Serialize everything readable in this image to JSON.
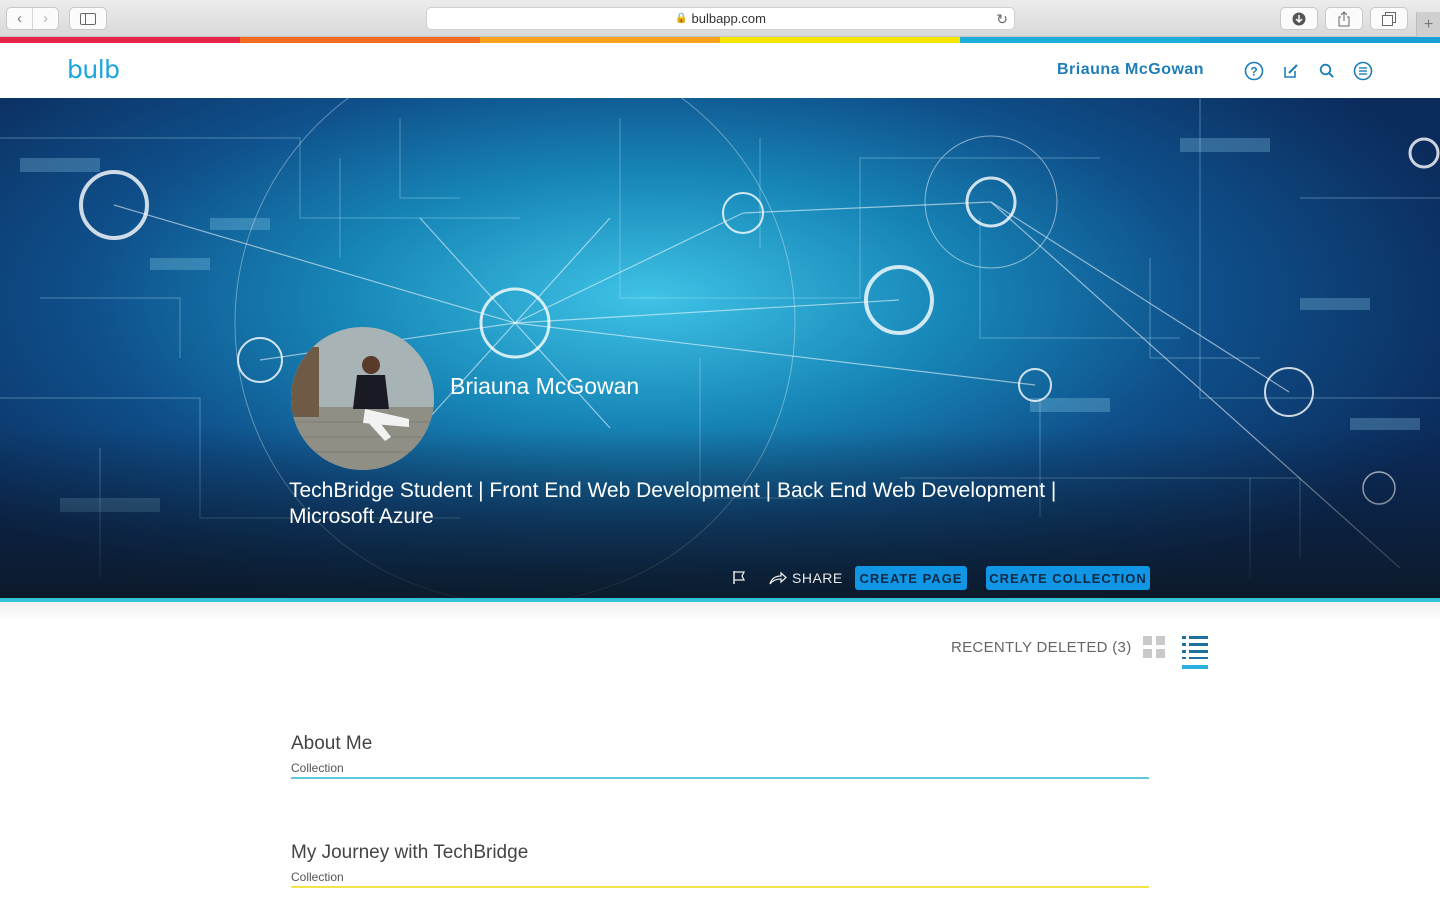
{
  "browser": {
    "url": "bulbapp.com",
    "lock_icon": "lock-icon",
    "reload_icon": "reload-icon"
  },
  "stripe_colors": [
    "#e8234a",
    "#f36c21",
    "#f7a21b",
    "#f5e500",
    "#1aaed9",
    "#1aa0d8"
  ],
  "header": {
    "logo": "bulb",
    "user_name": "Briauna McGowan",
    "icons": [
      "help-icon",
      "edit-icon",
      "search-icon",
      "menu-icon"
    ],
    "accent_color": "#1f7eb8"
  },
  "profile": {
    "name": "Briauna McGowan",
    "bio": "TechBridge Student | Front End Web Development | Back End Web Development | Microsoft Azure",
    "share_label": "SHARE",
    "create_page_label": "CREATE PAGE",
    "create_collection_label": "CREATE COLLECTION",
    "button_color": "#1196e6"
  },
  "toolbar": {
    "recently_deleted_label": "RECENTLY DELETED (3)",
    "active_view": "list"
  },
  "collections": [
    {
      "title": "About Me",
      "type": "Collection",
      "color": "#5fc7d9"
    },
    {
      "title": "My Journey with TechBridge",
      "type": "Collection",
      "color": "#f2e34b"
    }
  ]
}
